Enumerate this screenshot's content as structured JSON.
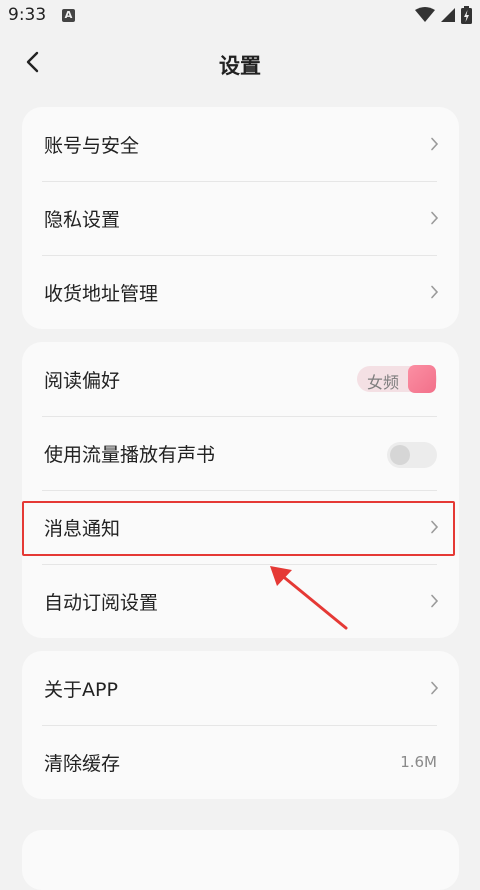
{
  "status_bar": {
    "time": "9:33",
    "badge": "A",
    "icons": [
      "wifi-icon",
      "signal-icon",
      "battery-icon"
    ]
  },
  "header": {
    "title": "设置",
    "back_icon": "chevron-left-icon"
  },
  "group1": {
    "items": [
      {
        "label": "账号与安全"
      },
      {
        "label": "隐私设置"
      },
      {
        "label": "收货地址管理"
      }
    ]
  },
  "group2": {
    "reading_pref": {
      "label": "阅读偏好",
      "value": "女频"
    },
    "audio_data": {
      "label": "使用流量播放有声书",
      "enabled": false
    },
    "notifications": {
      "label": "消息通知"
    },
    "auto_subscribe": {
      "label": "自动订阅设置"
    }
  },
  "group3": {
    "about": {
      "label": "关于APP"
    },
    "clear_cache": {
      "label": "清除缓存",
      "value": "1.6M"
    }
  },
  "colors": {
    "background": "#f2f2f2",
    "card": "#fafafa",
    "accent_pink": "#f2708a",
    "highlight_red": "#e53935"
  }
}
